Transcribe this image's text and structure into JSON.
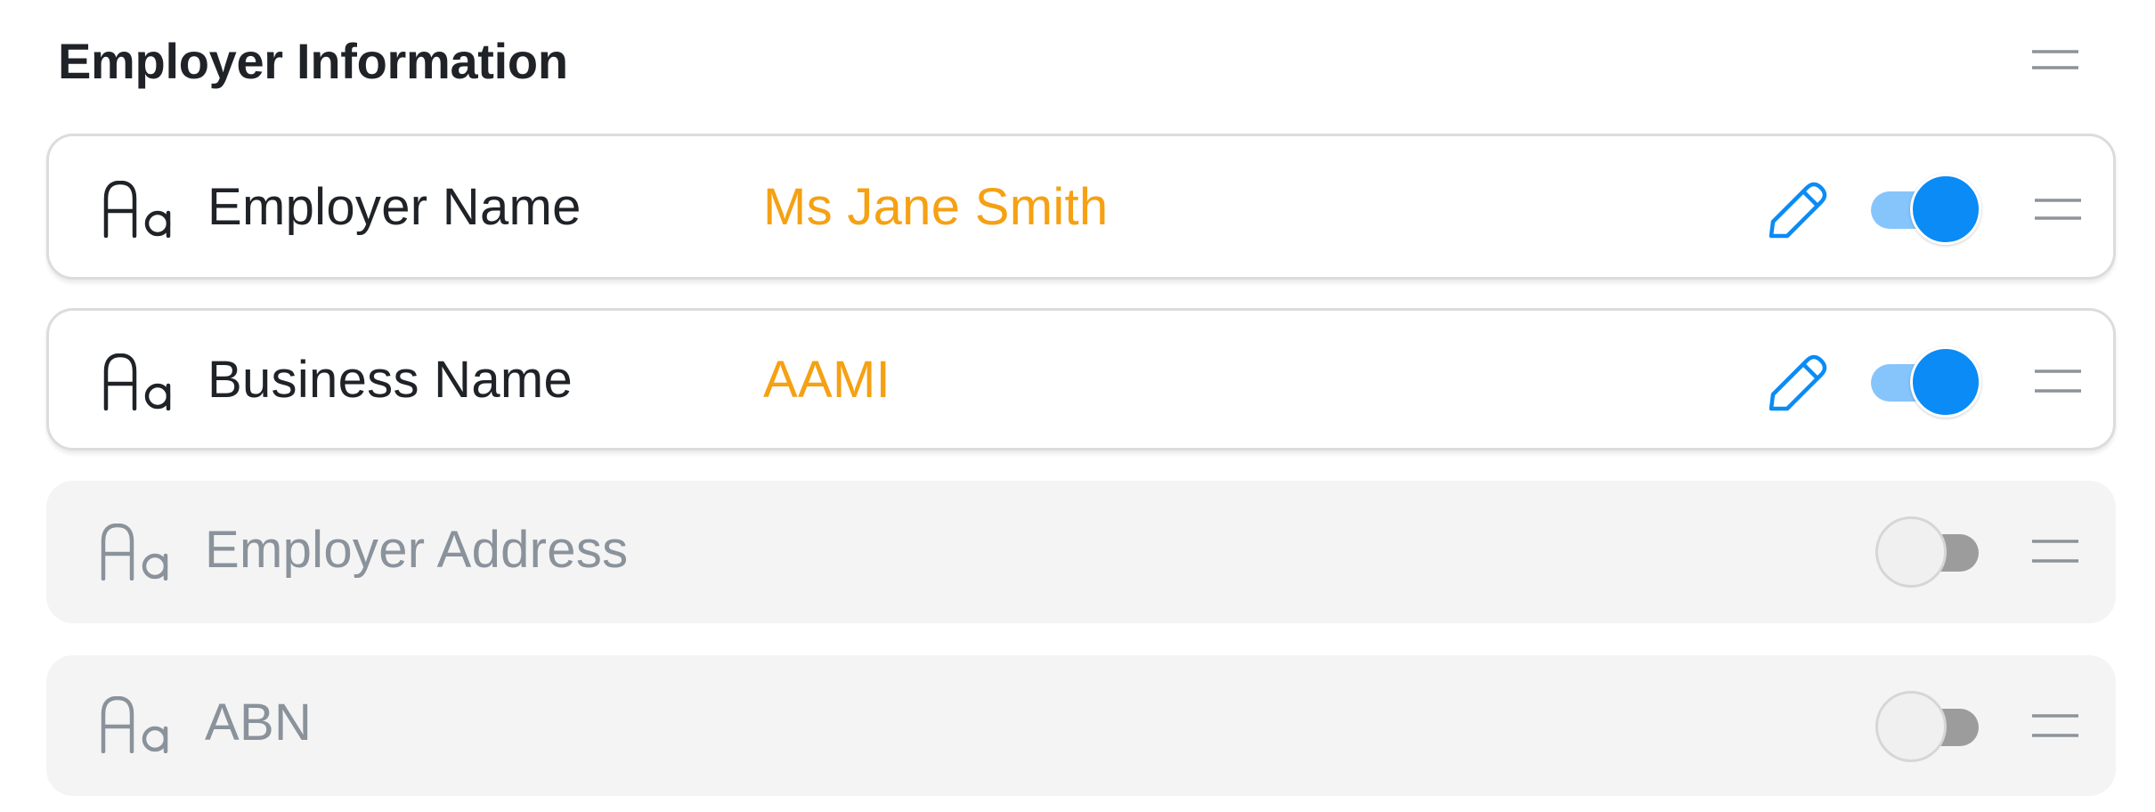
{
  "section": {
    "title": "Employer Information"
  },
  "fields": [
    {
      "label": "Employer Name",
      "value": "Ms Jane Smith",
      "enabled": true,
      "editable": true
    },
    {
      "label": "Business Name",
      "value": "AAMI",
      "enabled": true,
      "editable": true
    },
    {
      "label": "Employer Address",
      "value": "",
      "enabled": false,
      "editable": false
    },
    {
      "label": "ABN",
      "value": "",
      "enabled": false,
      "editable": false
    }
  ],
  "icons": {
    "field_type": "text-type-icon",
    "edit": "pencil-icon",
    "drag": "drag-handle-icon"
  },
  "colors": {
    "value_text": "#f5a113",
    "accent": "#0a8bf5",
    "accent_track": "#86c5fb",
    "disabled_label": "#8a929b",
    "disabled_row_bg": "#f4f4f4"
  }
}
